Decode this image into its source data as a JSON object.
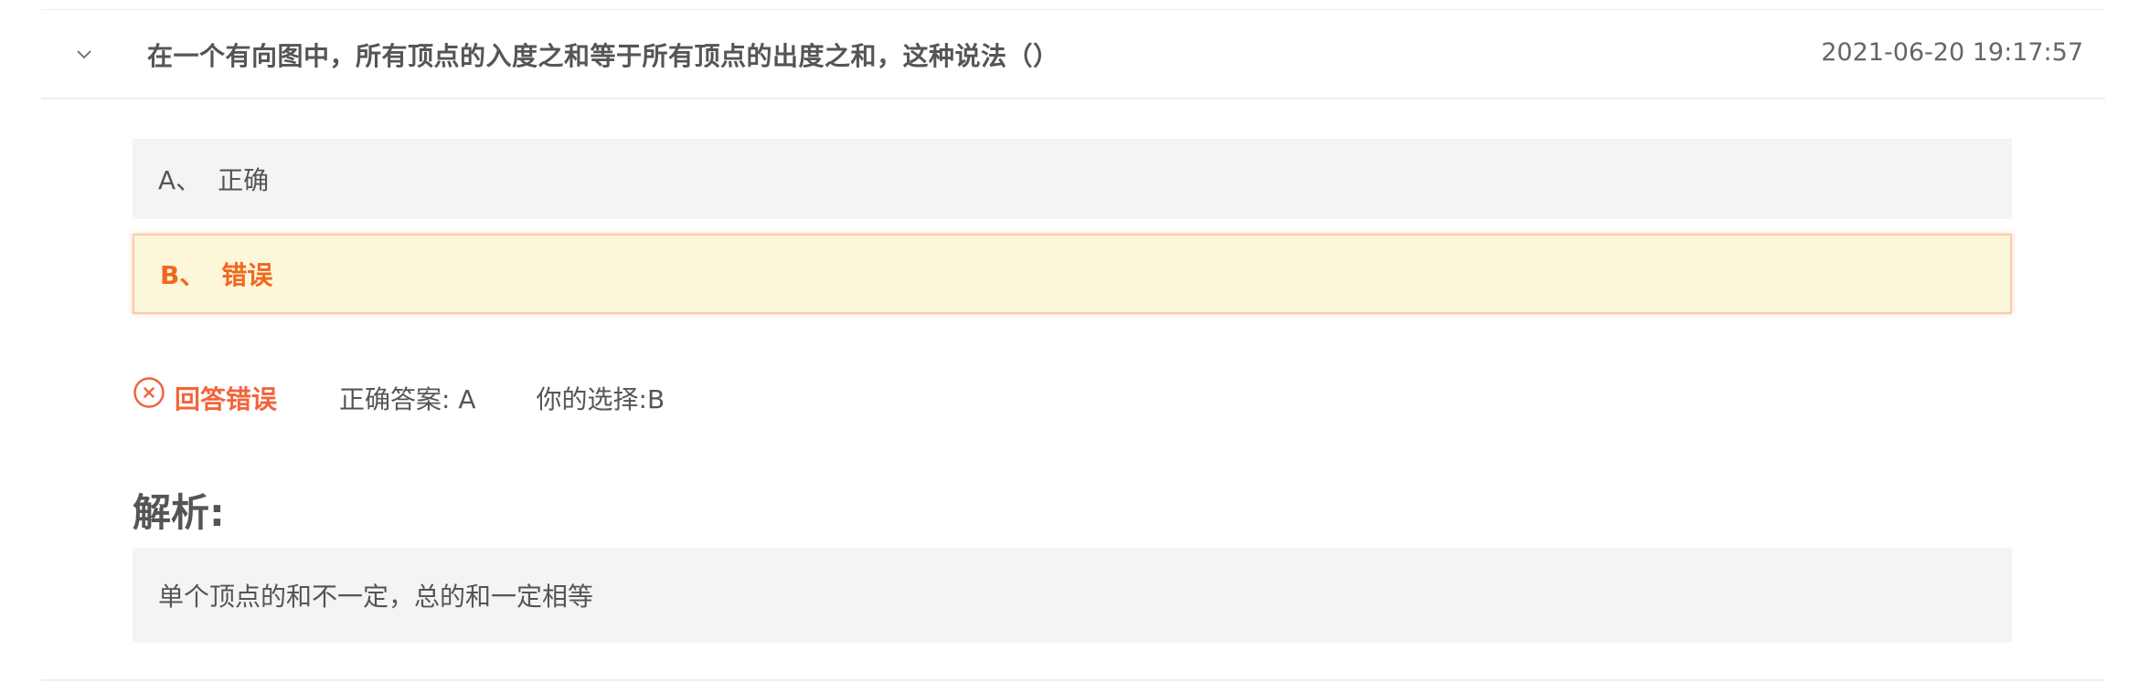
{
  "question": {
    "text": "在一个有向图中，所有顶点的入度之和等于所有顶点的出度之和，这种说法（）",
    "timestamp": "2021-06-20 19:17:57",
    "toggle_icon": "chevron-down-icon"
  },
  "options": [
    {
      "label": "A、",
      "text": "正确",
      "selected": false
    },
    {
      "label": "B、",
      "text": "错误",
      "selected": true
    }
  ],
  "result": {
    "status_icon": "x-circle-icon",
    "status_text": "回答错误",
    "correct_answer": "正确答案: A",
    "your_choice": "你的选择:B"
  },
  "analysis": {
    "title": "解析:",
    "text": "单个顶点的和不一定，总的和一定相等"
  },
  "colors": {
    "wrong": "#f2643a",
    "selected_text": "#f2671f",
    "selected_bg": "#fdf7d9",
    "option_bg": "#f4f4f4"
  }
}
